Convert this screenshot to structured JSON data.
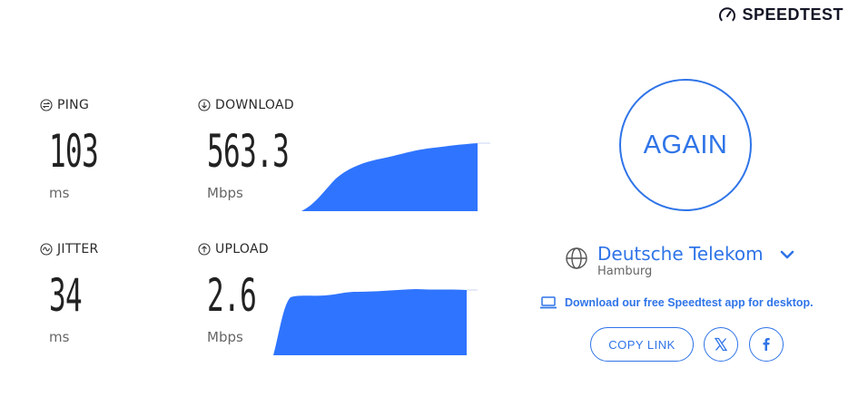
{
  "brand": {
    "name": "SPEEDTEST",
    "icon": "speedometer-icon"
  },
  "metrics": {
    "ping": {
      "label": "PING",
      "value": "103",
      "unit": "ms",
      "icon": "ping-icon"
    },
    "download": {
      "label": "DOWNLOAD",
      "value": "563.3",
      "unit": "Mbps",
      "icon": "download-arrow-icon"
    },
    "jitter": {
      "label": "JITTER",
      "value": "34",
      "unit": "ms",
      "icon": "jitter-icon"
    },
    "upload": {
      "label": "UPLOAD",
      "value": "2.6",
      "unit": "Mbps",
      "icon": "upload-arrow-icon"
    }
  },
  "again_button": {
    "label": "AGAIN"
  },
  "provider": {
    "name": "Deutsche Telekom",
    "location": "Hamburg",
    "icon": "globe-icon"
  },
  "download_app": {
    "label": "Download our free Speedtest app for desktop.",
    "icon": "laptop-icon"
  },
  "share": {
    "copy_link_label": "COPY LINK",
    "x_icon": "x-logo-icon",
    "facebook_icon": "facebook-icon"
  },
  "colors": {
    "accent": "#2f74e8",
    "graph_fill": "#2f74ff"
  }
}
